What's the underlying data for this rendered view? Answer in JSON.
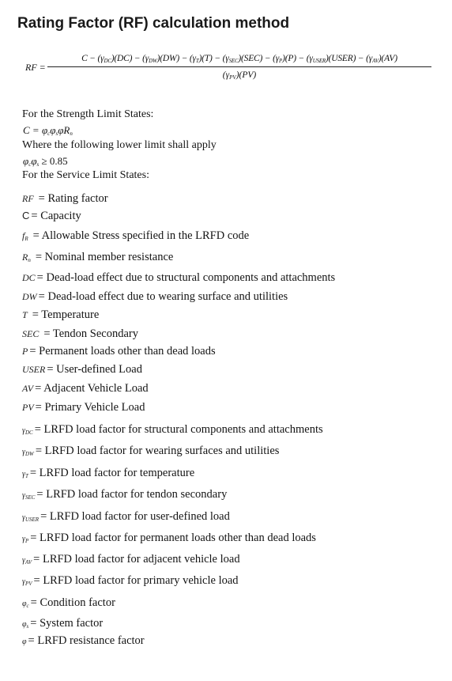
{
  "title": "Rating Factor (RF) calculation method",
  "formula": {
    "lhs": "RF =",
    "numerator": "C − (γDC)(DC) − (γDW)(DW) − (γT)(T) − (γSEC)(SEC) − (γP)(P) − (γUSER)(USER) − (γAV)(AV)",
    "numerator_terms": [
      {
        "text": "C − (γ",
        "sub": "DC",
        "after": ")(DC) − (γ"
      },
      {
        "text": "",
        "sub": "DW",
        "after": ")(DW) − (γ"
      },
      {
        "text": "",
        "sub": "T",
        "after": ")(T) − (γ"
      },
      {
        "text": "",
        "sub": "SEC",
        "after": ")(SEC) − (γ"
      },
      {
        "text": "",
        "sub": "P",
        "after": ")(P) − (γ"
      },
      {
        "text": "",
        "sub": "USER",
        "after": ")(USER) − (γ"
      },
      {
        "text": "",
        "sub": "AV",
        "after": ")(AV)"
      }
    ],
    "denominator_pre": "(γ",
    "denominator_sub": "PV",
    "denominator_post": ")(PV)"
  },
  "strength": {
    "heading": "For the Strength Limit States:",
    "capacity_eq": {
      "lhs": "C",
      "eq": "=",
      "rhs": "φ",
      "rhs_sub1": "c",
      "rhs2": "φ",
      "rhs_sub2": "s",
      "rhs3": "φR",
      "rhs_sub3": "n"
    },
    "limit_text": "Where the following lower limit shall apply",
    "limit_eq": {
      "a": "φ",
      "a_sub": "c",
      "b": "φ",
      "b_sub": "s",
      "rel": "≥ 0.85"
    }
  },
  "service": {
    "heading": "For the Service Limit States:"
  },
  "definitions": [
    {
      "symbol": "RF",
      "sub": "",
      "desc": "= Rating factor"
    },
    {
      "symbol": "C",
      "sub": "",
      "desc": "= Capacity",
      "upright": true
    },
    {
      "symbol": "f",
      "sub": "R",
      "desc": "= Allowable Stress specified in the LRFD code"
    },
    {
      "symbol": "R",
      "sub": "n",
      "desc": "= Nominal member resistance"
    },
    {
      "symbol": "DC",
      "sub": "",
      "desc": "= Dead-load effect due to structural components and attachments"
    },
    {
      "symbol": "DW",
      "sub": "",
      "desc": "= Dead-load effect due to wearing surface and utilities"
    },
    {
      "symbol": "T",
      "sub": "",
      "desc": "= Temperature"
    },
    {
      "symbol": "SEC",
      "sub": "",
      "desc": "= Tendon Secondary"
    },
    {
      "symbol": "P",
      "sub": "",
      "desc": "= Permanent loads other than dead loads"
    },
    {
      "symbol": "USER",
      "sub": "",
      "desc": "= User-defined Load"
    },
    {
      "symbol": "AV",
      "sub": "",
      "desc": "= Adjacent Vehicle Load"
    },
    {
      "symbol": "PV",
      "sub": "",
      "desc": "= Primary Vehicle Load"
    },
    {
      "symbol": "γ",
      "sub": "DC",
      "desc": "= LRFD load factor for structural components and attachments"
    },
    {
      "symbol": "γ",
      "sub": "DW",
      "desc": "= LRFD load factor for wearing surfaces and utilities"
    },
    {
      "symbol": "γ",
      "sub": "T",
      "desc": "= LRFD load factor for temperature"
    },
    {
      "symbol": "γ",
      "sub": "SEC",
      "desc": "= LRFD load factor for tendon secondary"
    },
    {
      "symbol": "γ",
      "sub": "USER",
      "desc": "= LRFD load factor for user-defined load"
    },
    {
      "symbol": "γ",
      "sub": "P",
      "desc": "= LRFD load factor for permanent loads other than dead loads"
    },
    {
      "symbol": "γ",
      "sub": "AV",
      "desc": "= LRFD load factor for adjacent vehicle load"
    },
    {
      "symbol": "γ",
      "sub": "PV",
      "desc": "= LRFD load factor for primary vehicle load"
    },
    {
      "symbol": "φ",
      "sub": "c",
      "desc": "= Condition factor"
    },
    {
      "symbol": "φ",
      "sub": "s",
      "desc": "= System factor"
    },
    {
      "symbol": "φ",
      "sub": "",
      "desc": "= LRFD resistance factor"
    }
  ]
}
